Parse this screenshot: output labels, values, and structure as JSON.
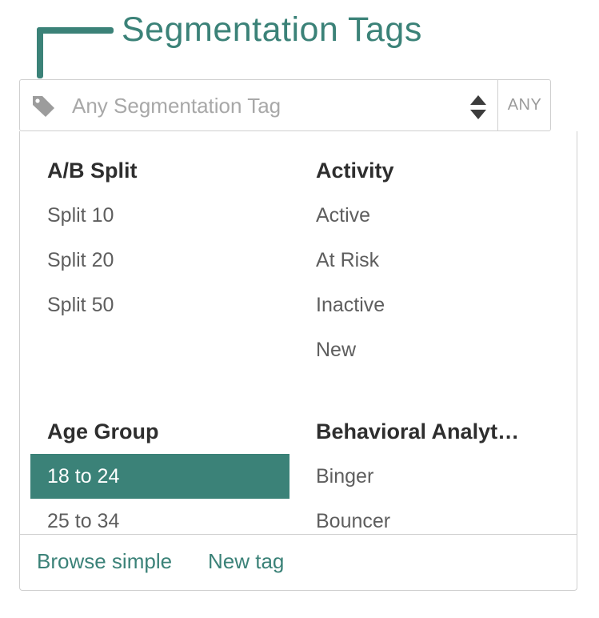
{
  "callout": {
    "title": "Segmentation Tags"
  },
  "select": {
    "placeholder": "Any Segmentation Tag",
    "mode_button": "ANY",
    "icons": {
      "left": "tag-icon",
      "right": "up-down-arrows-icon"
    }
  },
  "dropdown": {
    "groups": [
      {
        "title": "A/B Split",
        "items": [
          "Split 10",
          "Split 20",
          "Split 50"
        ]
      },
      {
        "title": "Activity",
        "items": [
          "Active",
          "At Risk",
          "Inactive",
          "New"
        ]
      },
      {
        "title": "Age Group",
        "items": [
          "18 to 24",
          "25 to 34"
        ],
        "selected_item": "18 to 24"
      },
      {
        "title": "Behavioral Analyt…",
        "items": [
          "Binger",
          "Bouncer"
        ]
      }
    ],
    "footer": {
      "browse_simple": "Browse simple",
      "new_tag": "New tag"
    }
  },
  "colors": {
    "accent": "#3b8278",
    "border": "#cfcfcf",
    "placeholder_text": "#a8a8a8",
    "heading_text": "#2e2e2e",
    "item_text": "#5e5e5e"
  }
}
